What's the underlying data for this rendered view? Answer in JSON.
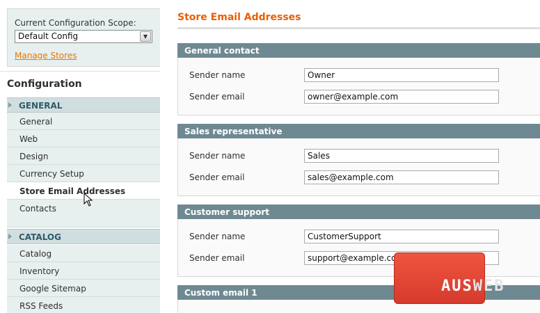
{
  "sidebar": {
    "scope_label": "Current Configuration Scope:",
    "scope_value": "Default Config",
    "manage_stores": "Manage Stores",
    "config_title": "Configuration",
    "groups": [
      {
        "title": "GENERAL",
        "items": [
          "General",
          "Web",
          "Design",
          "Currency Setup",
          "Store Email Addresses",
          "Contacts"
        ]
      },
      {
        "title": "CATALOG",
        "items": [
          "Catalog",
          "Inventory",
          "Google Sitemap",
          "RSS Feeds"
        ]
      }
    ],
    "active_item": "Store Email Addresses"
  },
  "main": {
    "title": "Store Email Addresses",
    "sections": [
      {
        "title": "General contact",
        "sender_name_label": "Sender name",
        "sender_name": "Owner",
        "sender_email_label": "Sender email",
        "sender_email": "owner@example.com"
      },
      {
        "title": "Sales representative",
        "sender_name_label": "Sender name",
        "sender_name": "Sales",
        "sender_email_label": "Sender email",
        "sender_email": "sales@example.com"
      },
      {
        "title": "Customer support",
        "sender_name_label": "Sender name",
        "sender_name": "CustomerSupport",
        "sender_email_label": "Sender email",
        "sender_email": "support@example.com"
      },
      {
        "title": "Custom email 1"
      }
    ]
  },
  "watermark": {
    "text_a": "AUS",
    "text_b": "WEB"
  },
  "colors": {
    "accent_orange": "#eb5e00",
    "link_orange": "#ea7601",
    "section_header": "#6f8992",
    "sidebar_bg": "#e7efef",
    "group_header_bg": "#d1dedf"
  },
  "icons": {
    "select_arrow": "chevron-down-icon",
    "group_marker": "triangle-right-icon",
    "cursor": "mouse-cursor-icon"
  }
}
